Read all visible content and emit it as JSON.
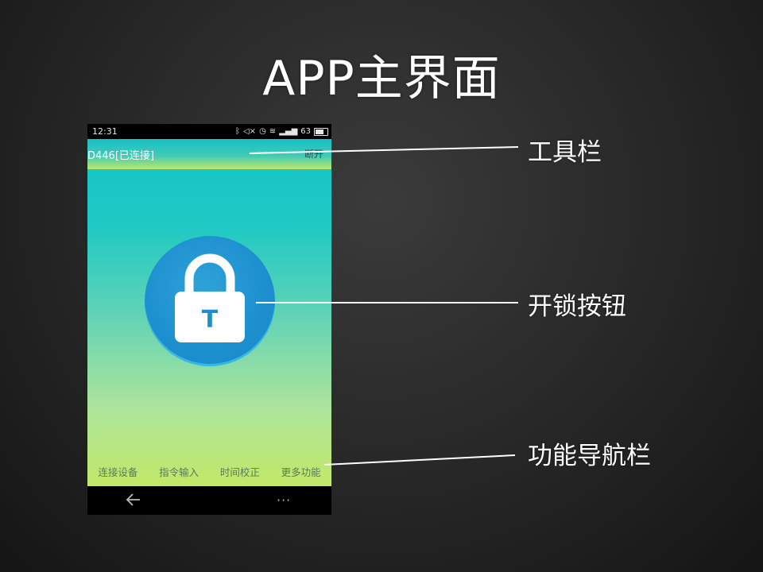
{
  "slide": {
    "title": "APP主界面"
  },
  "status_bar": {
    "time": "12:31",
    "battery_level": "63"
  },
  "toolbar": {
    "device_label": "D446[已连接]",
    "disconnect_label": "断开"
  },
  "lock_button": {
    "icon_letter": "T",
    "icon": "padlock-icon"
  },
  "bottom_nav": {
    "items": [
      {
        "label": "连接设备"
      },
      {
        "label": "指令输入"
      },
      {
        "label": "时间校正"
      },
      {
        "label": "更多功能"
      }
    ]
  },
  "system_nav": {
    "more_glyph": "···",
    "back_icon": "back-arrow-icon"
  },
  "callouts": {
    "toolbar": "工具栏",
    "unlock_button": "开锁按钮",
    "nav_bar": "功能导航栏"
  },
  "colors": {
    "background": "#2a2a2a",
    "app_gradient_top": "#14c4c8",
    "app_gradient_bottom": "#c2e868",
    "lock_circle": "#1c8fcf"
  }
}
